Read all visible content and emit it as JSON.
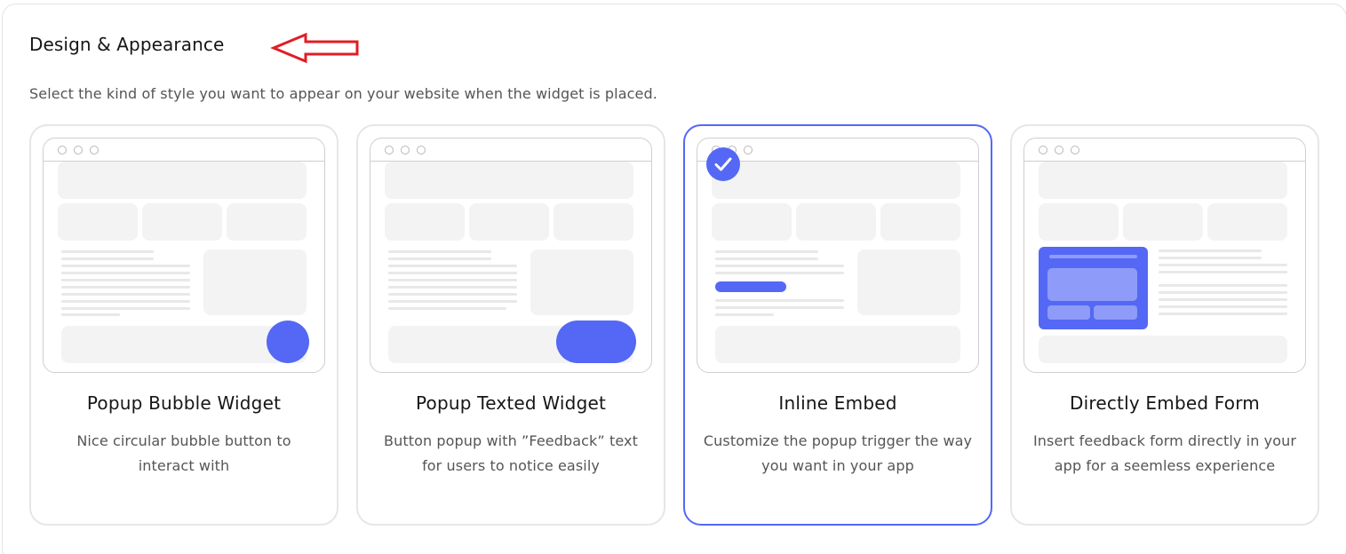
{
  "section": {
    "title": "Design & Appearance",
    "description": "Select the kind of style you want to appear on your website when the widget is placed.",
    "annotation_icon": "red-arrow-icon"
  },
  "options": [
    {
      "title": "Popup Bubble Widget",
      "description": "Nice circular bubble button to interact with",
      "selected": false
    },
    {
      "title": "Popup Texted Widget",
      "description": "Button popup with ”Feedback” text for users to notice easily",
      "selected": false
    },
    {
      "title": "Inline Embed",
      "description": "Customize the popup trigger the way you want in your app",
      "selected": true
    },
    {
      "title": "Directly Embed Form",
      "description": "Insert feedback form directly in your app for a seemless experience",
      "selected": false
    }
  ],
  "colors": {
    "accent": "#5468f5",
    "accent_light": "#8e9bf8",
    "annotation": "#e11d24",
    "card_border": "#e6e6e6"
  }
}
